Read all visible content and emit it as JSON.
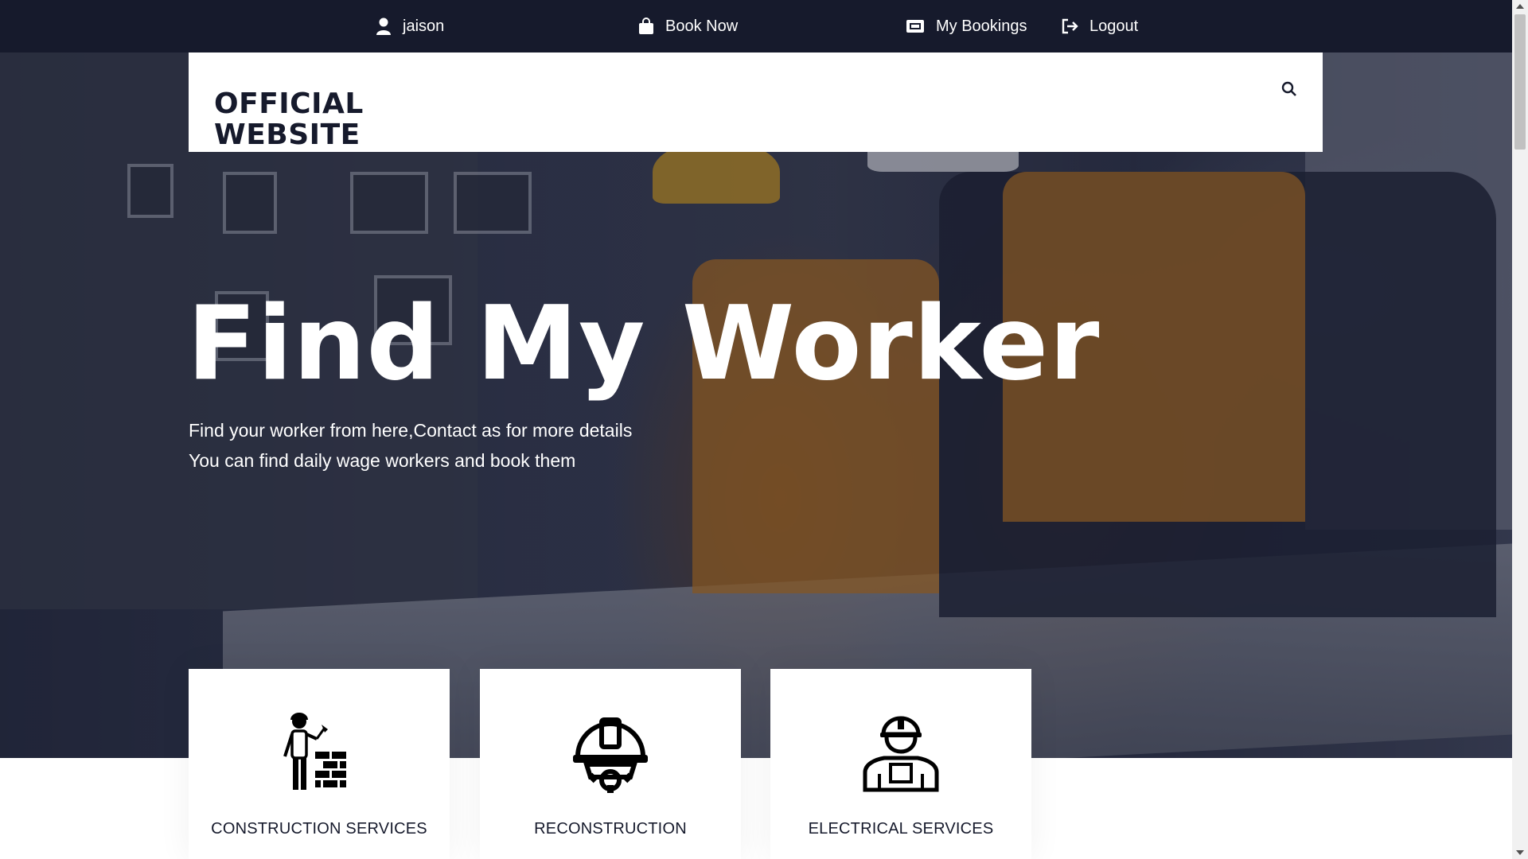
{
  "topbar": {
    "user": {
      "label": "jaison",
      "icon": "user-icon"
    },
    "book": {
      "label": "Book Now",
      "icon": "shopping-bag-icon"
    },
    "bookings": {
      "label": "My Bookings",
      "icon": "ticket-icon"
    },
    "logout": {
      "label": "Logout",
      "icon": "logout-icon"
    }
  },
  "header": {
    "logo_line1": "OFFICIAL",
    "logo_line2": "WEBSITE",
    "search_icon": "search-icon"
  },
  "hero": {
    "title": "Find My Worker",
    "subtitle_line1": "Find your worker from here,Contact as for more details",
    "subtitle_line2": "You can find daily wage workers and book them"
  },
  "services": [
    {
      "label": "CONSTRUCTION SERVICES",
      "icon": "bricklayer-worker-icon"
    },
    {
      "label": "RECONSTRUCTION",
      "icon": "helmet-gear-icon"
    },
    {
      "label": "ELECTRICAL SERVICES",
      "icon": "worker-person-icon"
    }
  ],
  "colors": {
    "topbar_bg": "#161a2c",
    "text_dark": "#161a2c",
    "white": "#ffffff"
  }
}
